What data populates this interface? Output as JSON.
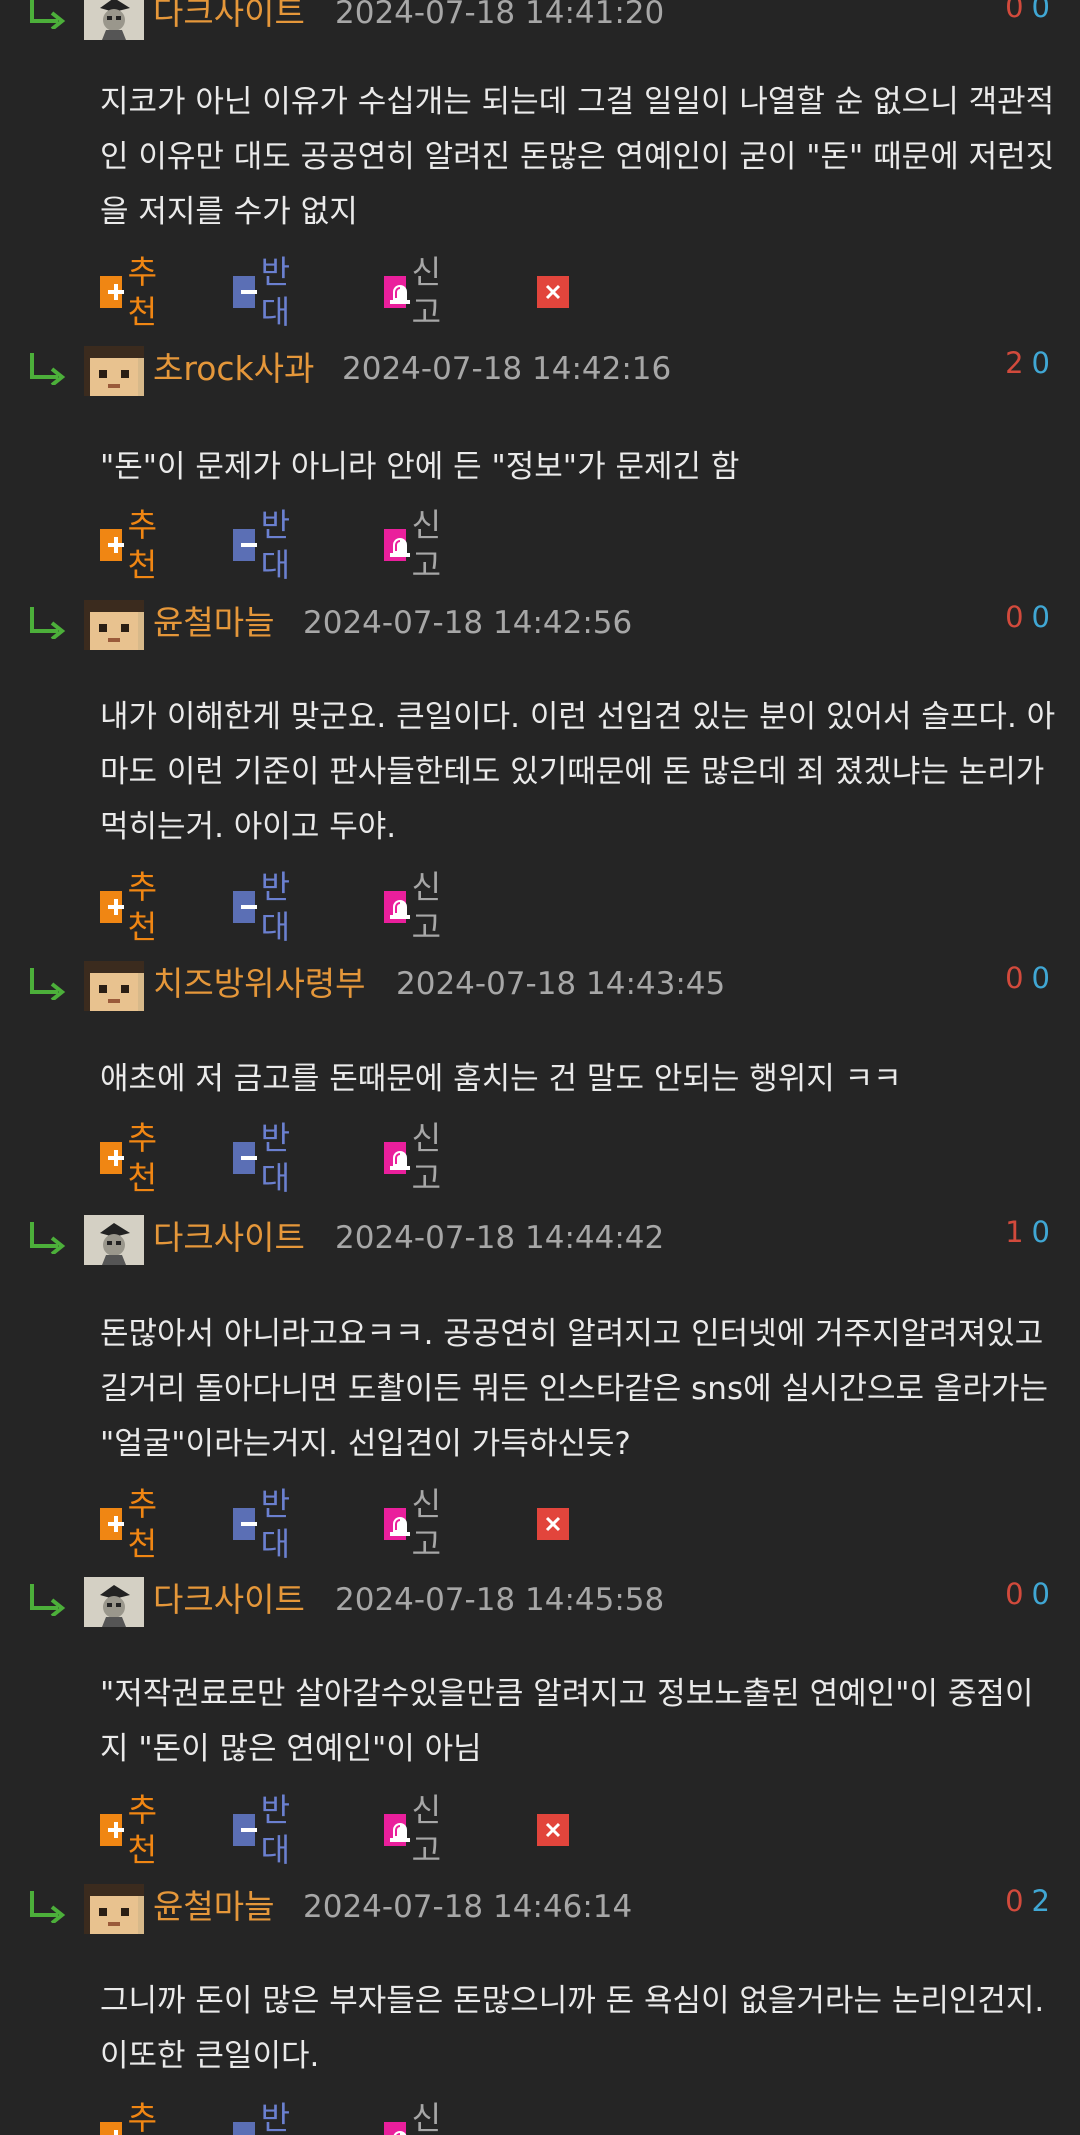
{
  "labels": {
    "recommend": "추천",
    "oppose": "반대",
    "report": "신고"
  },
  "colors": {
    "background": "#252525",
    "nick": "#e5973a",
    "recommend": "#f08613",
    "oppose": "#6b80d0",
    "vote_up": "#d24a3c",
    "vote_down": "#40a7d4",
    "report": "#ea1f9c",
    "delete": "#e2453c"
  },
  "comments": [
    {
      "nick": "다크사이트",
      "date": "2024-07-18 14:41:20",
      "up": "0",
      "down": "0",
      "avatar": "dark-site-avatar",
      "deletable": true,
      "body": "지코가 아닌 이유가 수십개는 되는데 그걸 일일이 나열할 순 없으니 객관적인 이유만 대도 공공연히 알려진 돈많은 연예인이 굳이 \"돈\" 때문에 저런짓을 저지를 수가 없지"
    },
    {
      "nick": "초rock사과",
      "date": "2024-07-18 14:42:16",
      "up": "2",
      "down": "0",
      "avatar": "pixel-face-avatar",
      "deletable": false,
      "body": "\"돈\"이 문제가 아니라 안에 든 \"정보\"가 문제긴 함"
    },
    {
      "nick": "윤철마늘",
      "date": "2024-07-18 14:42:56",
      "up": "0",
      "down": "0",
      "avatar": "pixel-face-avatar",
      "deletable": false,
      "body": "내가 이해한게 맞군요. 큰일이다. 이런 선입견 있는 분이 있어서 슬프다. 아마도 이런 기준이 판사들한테도 있기때문에 돈 많은데 죄 졌겠냐는 논리가 먹히는거. 아이고 두야."
    },
    {
      "nick": "치즈방위사령부",
      "date": "2024-07-18 14:43:45",
      "up": "0",
      "down": "0",
      "avatar": "pixel-face-avatar",
      "deletable": false,
      "body": "애초에 저 금고를 돈때문에 훔치는 건 말도 안되는 행위지 ㅋㅋ"
    },
    {
      "nick": "다크사이트",
      "date": "2024-07-18 14:44:42",
      "up": "1",
      "down": "0",
      "avatar": "dark-site-avatar",
      "deletable": true,
      "body": "돈많아서 아니라고요ㅋㅋ. 공공연히 알려지고 인터넷에 거주지알려져있고 길거리 돌아다니면 도촬이든 뭐든 인스타같은 sns에 실시간으로 올라가는 \"얼굴\"이라는거지. 선입견이 가득하신듯?"
    },
    {
      "nick": "다크사이트",
      "date": "2024-07-18 14:45:58",
      "up": "0",
      "down": "0",
      "avatar": "dark-site-avatar",
      "deletable": true,
      "body": "\"저작권료로만 살아갈수있을만큼 알려지고 정보노출된 연예인\"이 중점이지 \"돈이 많은 연예인\"이 아님"
    },
    {
      "nick": "윤철마늘",
      "date": "2024-07-18 14:46:14",
      "up": "0",
      "down": "2",
      "avatar": "pixel-face-avatar",
      "deletable": false,
      "body": "그니까 돈이 많은 부자들은 돈많으니까 돈 욕심이 없을거라는 논리인건지. 이또한 큰일이다."
    }
  ]
}
